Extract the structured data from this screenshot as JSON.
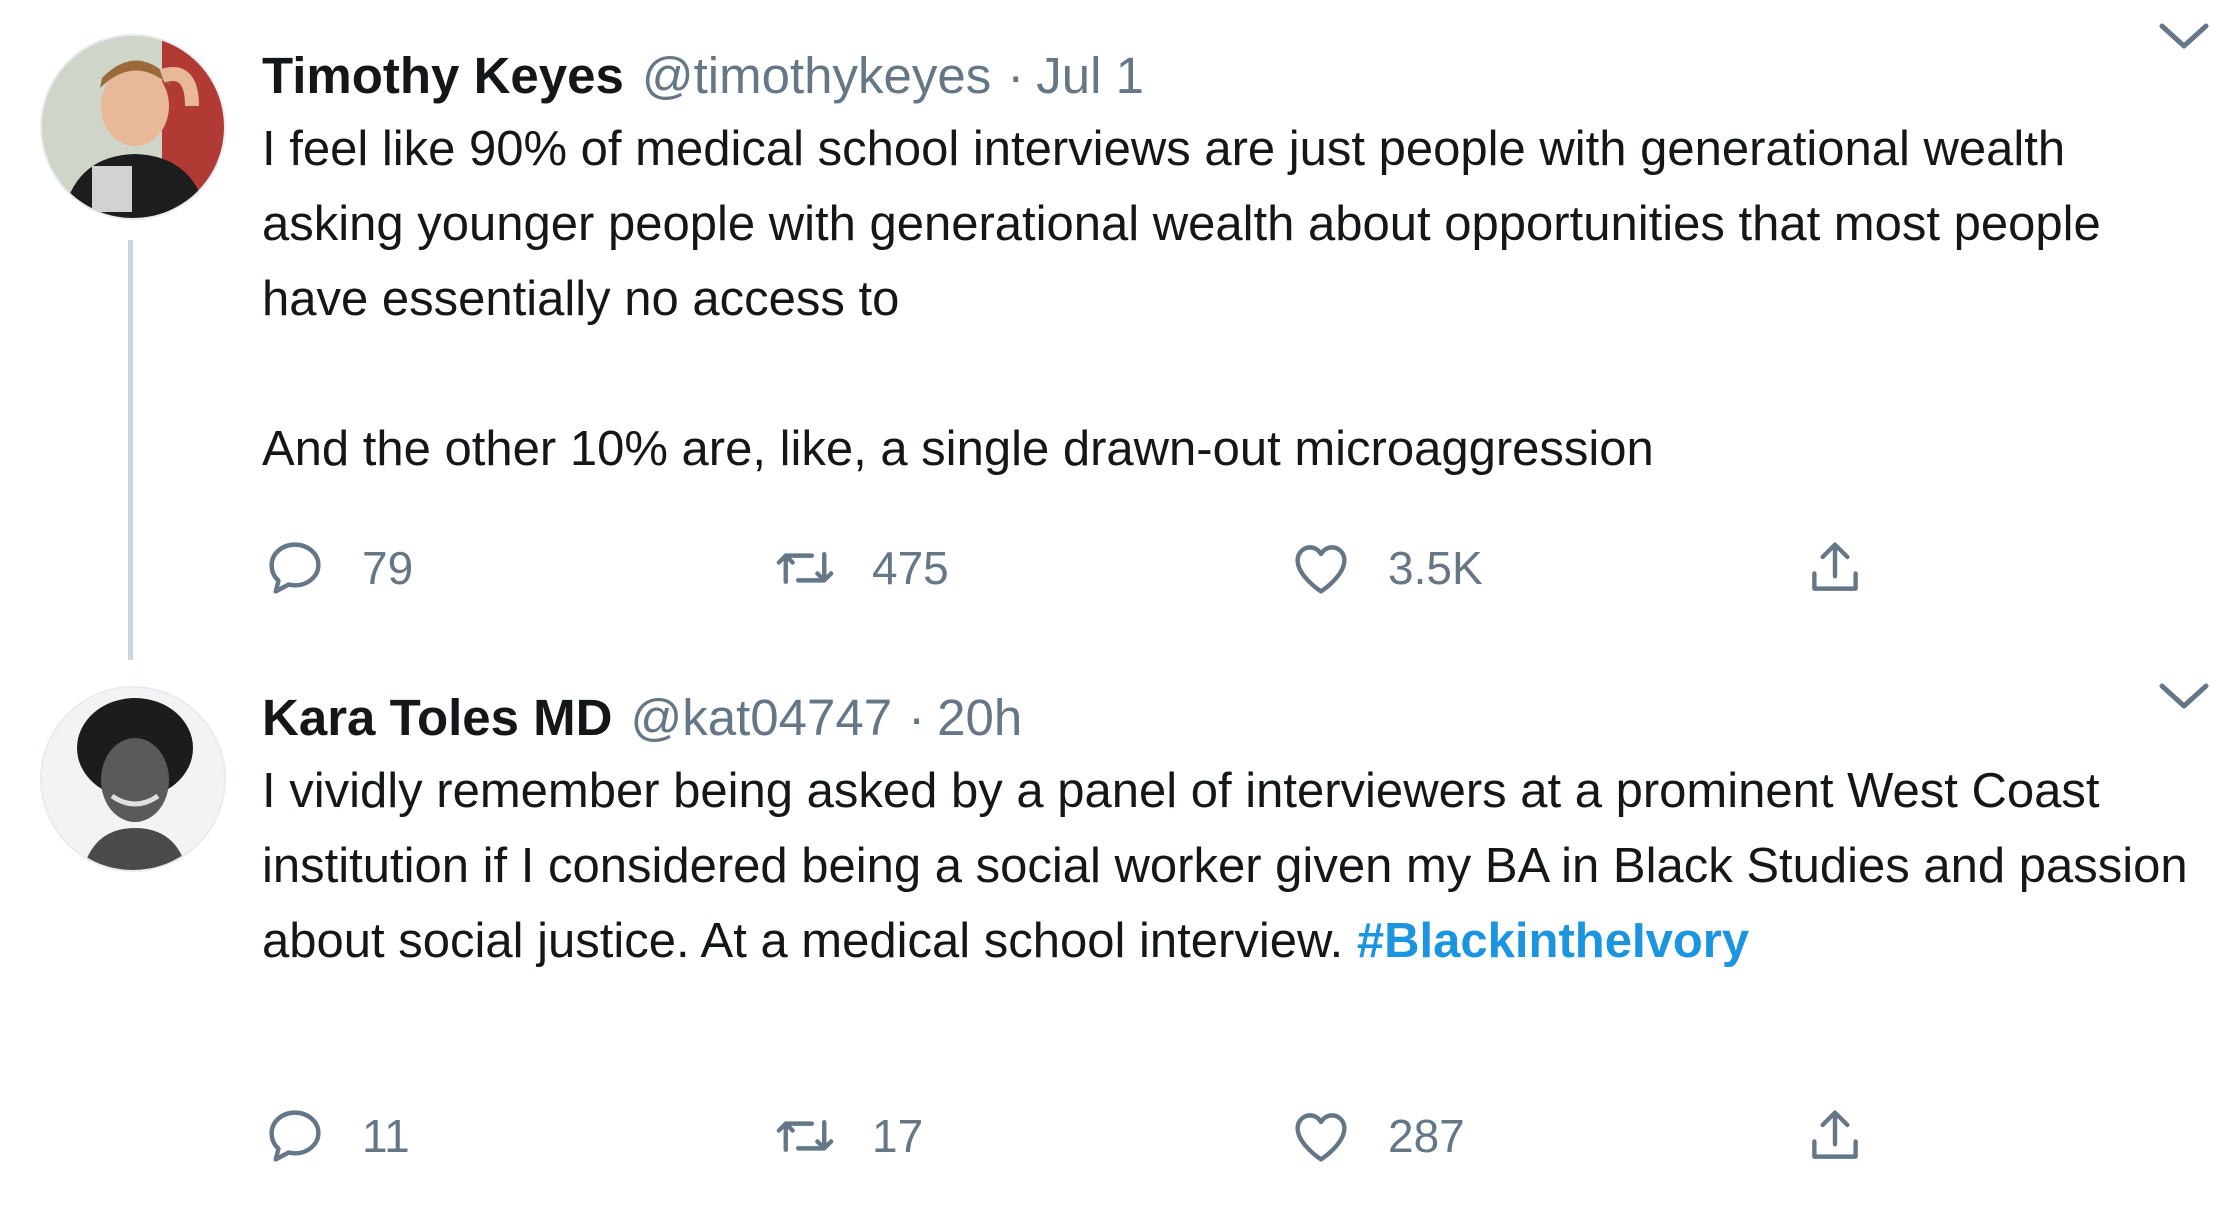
{
  "tweets": [
    {
      "display_name": "Timothy Keyes",
      "handle": "@timothykeyes",
      "separator": "·",
      "time": "Jul 1",
      "avatar": "avatar-photo",
      "text_paragraphs": [
        "I feel like 90% of medical school interviews are just people with generational wealth asking younger people with generational wealth about opportunities that most people have essentially no access to",
        "And the other 10% are, like, a single drawn-out microaggression"
      ],
      "counts": {
        "replies": "79",
        "retweets": "475",
        "likes": "3.5K"
      }
    },
    {
      "display_name": "Kara Toles MD",
      "handle": "@kat04747",
      "separator": "·",
      "time": "20h",
      "avatar": "avatar-photo",
      "text": "I vividly remember being asked by a panel of interviewers at a prominent West Coast institution if I considered being a social worker given my BA in Black Studies and passion about social justice. At a medical school interview.",
      "hashtag": "#BlackintheIvory",
      "counts": {
        "replies": "11",
        "retweets": "17",
        "likes": "287"
      }
    }
  ],
  "icons": {
    "reply": "reply-icon",
    "retweet": "retweet-icon",
    "like": "heart-icon",
    "share": "share-icon",
    "menu": "chevron-down-icon"
  },
  "colors": {
    "text": "#14171a",
    "secondary": "#657786",
    "hashtag": "#1b95e0",
    "thread_line": "#ccd6dd"
  }
}
